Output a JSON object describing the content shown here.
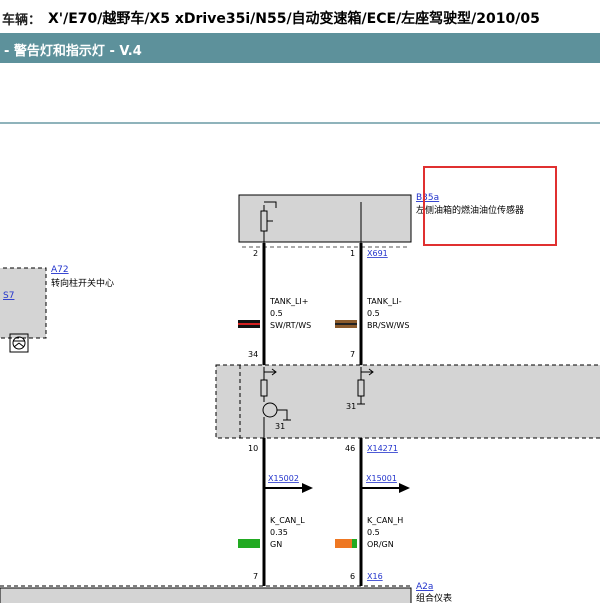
{
  "vehicle": {
    "label": "车辆：",
    "value": "X'/E70/越野车/X5 xDrive35i/N55/自动变速箱/ECE/左座驾驶型/2010/05"
  },
  "page": {
    "title": "- 警告灯和指示灯 - V.4"
  },
  "components": {
    "b35a": {
      "code": "B35a",
      "name": "左侧油箱的燃油油位传感器"
    },
    "a72": {
      "code": "A72",
      "name": "转向柱开关中心",
      "pin_link": "S7"
    },
    "a2a": {
      "code": "A2a",
      "name": "组合仪表"
    }
  },
  "connectors": {
    "x691": "X691",
    "x14271": "X14271",
    "x15002": "X15002",
    "x15001": "X15001",
    "x16": "X16"
  },
  "pins": {
    "p2": "2",
    "p1": "1",
    "p34": "34",
    "p7a": "7",
    "p10": "10",
    "p46": "46",
    "p7b": "7",
    "p6": "6",
    "g31a": "31",
    "g31b": "31"
  },
  "wires": {
    "w1": {
      "signal": "TANK_LI+",
      "size": "0.5",
      "color": "SW/RT/WS",
      "swatch": "#111111",
      "stripe": "#d32020"
    },
    "w2": {
      "signal": "TANK_LI-",
      "size": "0.5",
      "color": "BR/SW/WS",
      "swatch": "#8a5a2b",
      "stripe": "#222222"
    },
    "w3": {
      "signal": "K_CAN_L",
      "size": "0.35",
      "color": "GN",
      "swatch": "#22aa22"
    },
    "w4": {
      "signal": "K_CAN_H",
      "size": "0.5",
      "color": "OR/GN",
      "swatch": "#ee7722",
      "stripe": "#22aa22"
    }
  },
  "colors": {
    "highlight": "#e03030",
    "title_bg": "#5d919b",
    "box_fill": "#d4d4d4",
    "link": "#2233cc"
  }
}
